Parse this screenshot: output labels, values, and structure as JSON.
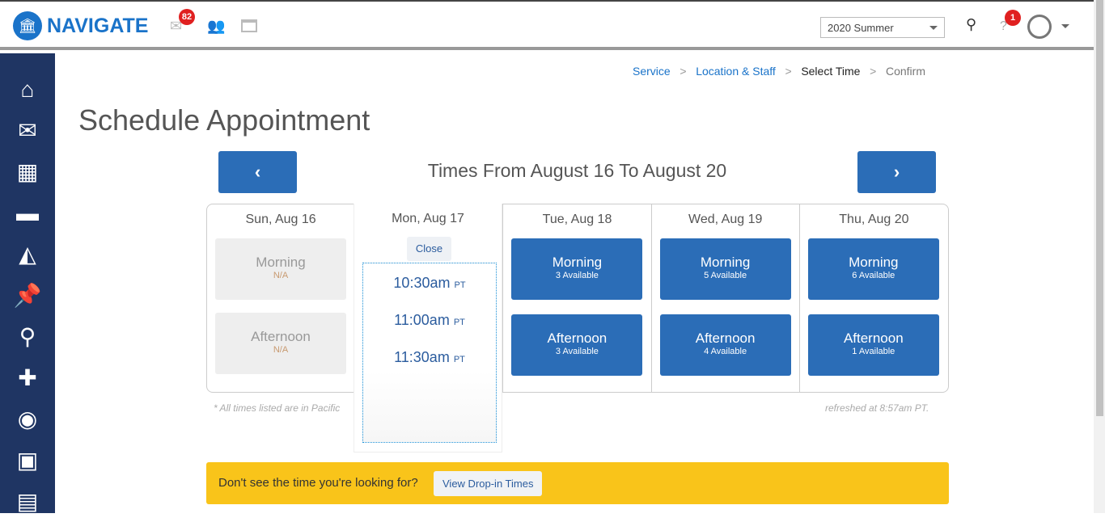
{
  "header": {
    "brand": "NAVIGATE",
    "mail_count": "82",
    "term": "2020 Summer",
    "help_count": "1",
    "help_label": "?"
  },
  "sidebar": {
    "icons": [
      "home-icon",
      "mail-icon",
      "calendar-icon",
      "folder-icon",
      "chart-icon",
      "pin-icon",
      "search-icon",
      "tag-icon",
      "pulse-icon",
      "presentation-icon",
      "document-icon"
    ]
  },
  "breadcrumb": [
    {
      "label": "Service",
      "state": "link"
    },
    {
      "label": "Location & Staff",
      "state": "link"
    },
    {
      "label": "Select Time",
      "state": "current"
    },
    {
      "label": "Confirm",
      "state": "future"
    }
  ],
  "page_title": "Schedule Appointment",
  "range_title": "Times From August 16 To August 20",
  "prev_label": "‹",
  "next_label": "›",
  "days": [
    {
      "label": "Sun, Aug 16",
      "morning": {
        "name": "Morning",
        "avail": "N/A",
        "enabled": false
      },
      "afternoon": {
        "name": "Afternoon",
        "avail": "N/A",
        "enabled": false
      }
    },
    {
      "label": "Mon, Aug 17",
      "close_label": "Close",
      "times": [
        {
          "t": "10:30am",
          "tz": "PT"
        },
        {
          "t": "11:00am",
          "tz": "PT"
        },
        {
          "t": "11:30am",
          "tz": "PT"
        }
      ]
    },
    {
      "label": "Tue, Aug 18",
      "morning": {
        "name": "Morning",
        "avail": "3 Available",
        "enabled": true
      },
      "afternoon": {
        "name": "Afternoon",
        "avail": "3 Available",
        "enabled": true
      }
    },
    {
      "label": "Wed, Aug 19",
      "morning": {
        "name": "Morning",
        "avail": "5 Available",
        "enabled": true
      },
      "afternoon": {
        "name": "Afternoon",
        "avail": "4 Available",
        "enabled": true
      }
    },
    {
      "label": "Thu, Aug 20",
      "morning": {
        "name": "Morning",
        "avail": "6 Available",
        "enabled": true
      },
      "afternoon": {
        "name": "Afternoon",
        "avail": "1 Available",
        "enabled": true
      }
    }
  ],
  "note_left": "* All times listed are in Pacific",
  "note_right": "refreshed at 8:57am PT.",
  "banner": {
    "question": "Don't see the time you're looking for?",
    "button": "View Drop-in Times"
  },
  "colors": {
    "primary": "#2b6db7",
    "sidebar": "#1f3563",
    "banner": "#f9c41a",
    "badge": "#e02020"
  }
}
